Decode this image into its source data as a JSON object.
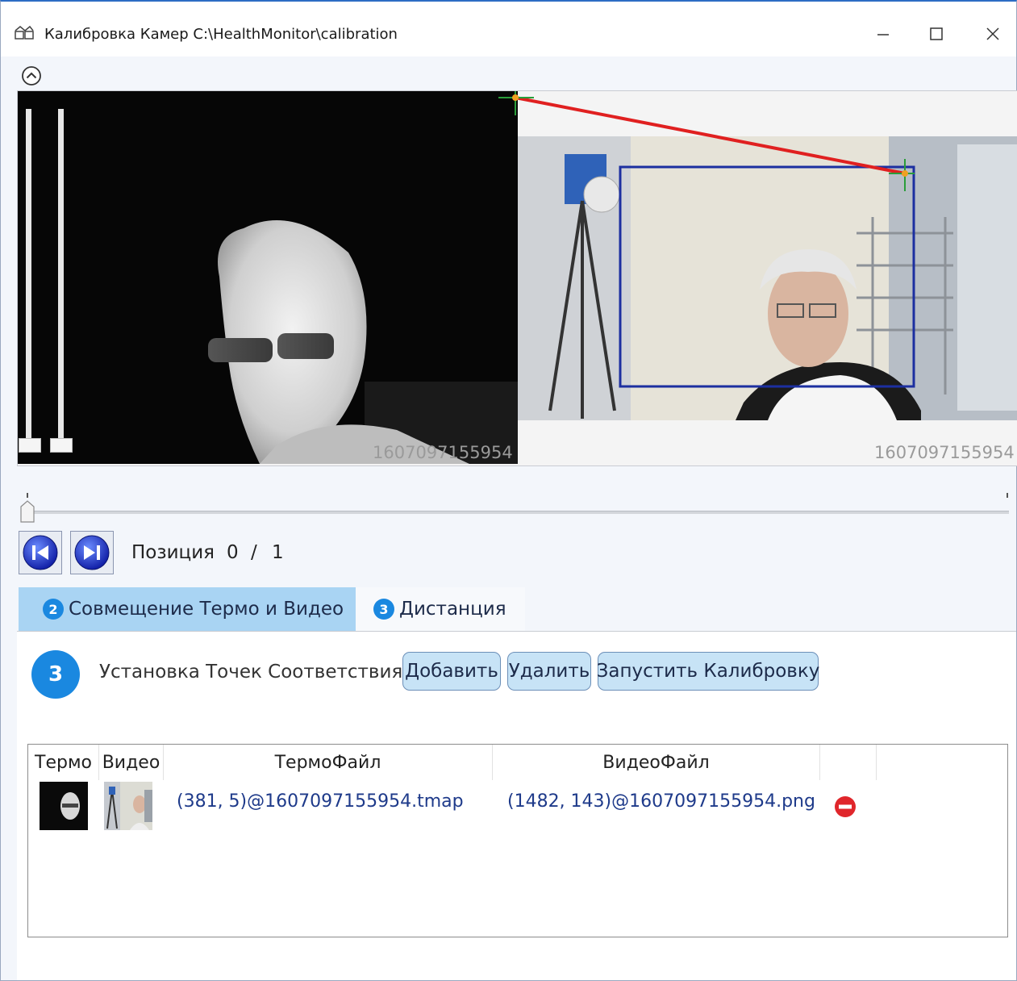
{
  "window": {
    "title": "Калибровка Камер C:\\HealthMonitor\\calibration",
    "controls": [
      "minimize-icon",
      "maximize-icon",
      "close-icon"
    ]
  },
  "cameras": {
    "thermo_timestamp": "1607097155954",
    "video_timestamp": "1607097155954"
  },
  "navigation": {
    "position_label": "Позиция",
    "current": "0",
    "separator": "/",
    "total": "1"
  },
  "tabs": [
    {
      "badge": "2",
      "label": "Совмещение Термо и Видео",
      "active": true
    },
    {
      "badge": "3",
      "label": "Дистанция",
      "active": false
    }
  ],
  "step": {
    "badge": "3",
    "label": "Установка Точек Соответствия",
    "buttons": {
      "add": "Добавить",
      "delete": "Удалить",
      "run": "Запустить Калибровку"
    }
  },
  "table": {
    "columns": [
      "Термо",
      "Видео",
      "ТермоФайл",
      "ВидеоФайл",
      "",
      ""
    ],
    "rows": [
      {
        "thermo_file": "(381, 5)@1607097155954.tmap",
        "video_file": "(1482, 143)@1607097155954.png",
        "action_icon": "remove-icon"
      }
    ]
  },
  "colors": {
    "accent": "#1a88e0",
    "active_tab": "#a9d4f3",
    "button_bg": "#c7e3f6",
    "link_text": "#1e3a8a",
    "correspondence_line": "#e02020",
    "roi_box": "#1c2fa0"
  }
}
